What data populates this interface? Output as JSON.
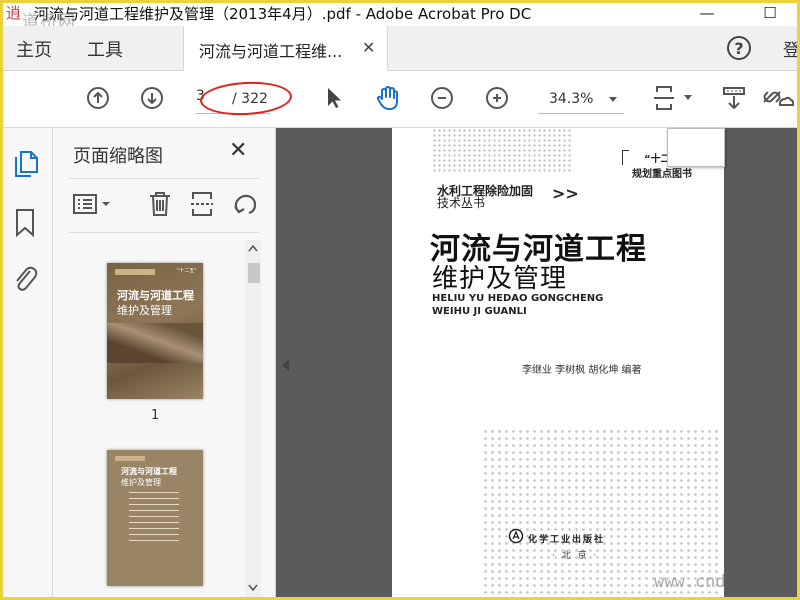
{
  "window": {
    "title": "河流与河道工程维护及管理（2013年4月）.pdf - Adobe Acrobat Pro DC",
    "watermark_top": "道桥网",
    "watermark_bottom": "www.cnd",
    "logo_glyph": "逍",
    "minimize": "—",
    "maximize": "☐"
  },
  "tabs": {
    "home": "主页",
    "tools": "工具",
    "document": "河流与河道工程维...",
    "close": "✕",
    "help": "?",
    "signin": "登"
  },
  "toolbar": {
    "current_page": "3",
    "total_pages": "/ 322",
    "zoom": "34.3%",
    "highlight_color": "#e0201b",
    "accent_color": "#1a73c8"
  },
  "sidebar": {
    "panel_title": "页面缩略图",
    "close": "✕",
    "thumbnail_1_label": "1",
    "thumb1": {
      "tag": "\"十二五\"",
      "title1": "河流与河道工程",
      "title2": "维护及管理"
    },
    "thumb2": {
      "title1": "河流与河道工程",
      "title2": "维护及管理"
    }
  },
  "page": {
    "series_tag": "“十二五”",
    "series_tag2": "规划重点图书",
    "series_line1": "水利工程除险加固",
    "series_line2": "技术丛书",
    "series_arrow": ">>",
    "title": "河流与河道工程",
    "subtitle": "维护及管理",
    "pinyin1": "HELIU YU HEDAO GONGCHENG",
    "pinyin2": "WEIHU JI GUANLI",
    "authors": "李继业    李树枫    胡化坤    编著",
    "publisher": "化学工业出版社",
    "city": "· 北 京 ·"
  }
}
